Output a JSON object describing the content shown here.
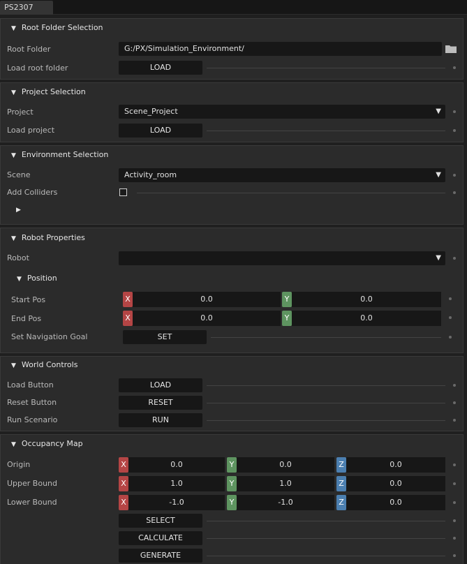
{
  "tab": {
    "label": "PS2307"
  },
  "root_folder": {
    "title": "Root Folder Selection",
    "root_folder_label": "Root Folder",
    "root_folder_value": "G:/PX/Simulation_Environment/",
    "load_label": "Load root folder",
    "load_button": "LOAD"
  },
  "project": {
    "title": "Project Selection",
    "project_label": "Project",
    "project_value": "Scene_Project",
    "load_label": "Load project",
    "load_button": "LOAD"
  },
  "environment": {
    "title": "Environment Selection",
    "scene_label": "Scene",
    "scene_value": "Activity_room",
    "colliders_label": "Add Colliders",
    "colliders_checked": false
  },
  "robot": {
    "title": "Robot Properties",
    "robot_label": "Robot",
    "robot_value": "",
    "position_title": "Position",
    "start_label": "Start Pos",
    "start_x": "0.0",
    "start_y": "0.0",
    "end_label": "End Pos",
    "end_x": "0.0",
    "end_y": "0.0",
    "nav_goal_label": "Set Navigation Goal",
    "set_button": "SET"
  },
  "world": {
    "title": "World Controls",
    "load_label": "Load Button",
    "load_button": "LOAD",
    "reset_label": "Reset Button",
    "reset_button": "RESET",
    "run_label": "Run Scenario",
    "run_button": "RUN"
  },
  "occupancy": {
    "title": "Occupancy Map",
    "origin_label": "Origin",
    "origin": {
      "x": "0.0",
      "y": "0.0",
      "z": "0.0"
    },
    "upper_label": "Upper Bound",
    "upper": {
      "x": "1.0",
      "y": "1.0",
      "z": "0.0"
    },
    "lower_label": "Lower Bound",
    "lower": {
      "x": "-1.0",
      "y": "-1.0",
      "z": "0.0"
    },
    "select_button": "SELECT",
    "calculate_button": "CALCULATE",
    "generate_button": "GENERATE"
  },
  "axes": {
    "x": "X",
    "y": "Y",
    "z": "Z"
  }
}
